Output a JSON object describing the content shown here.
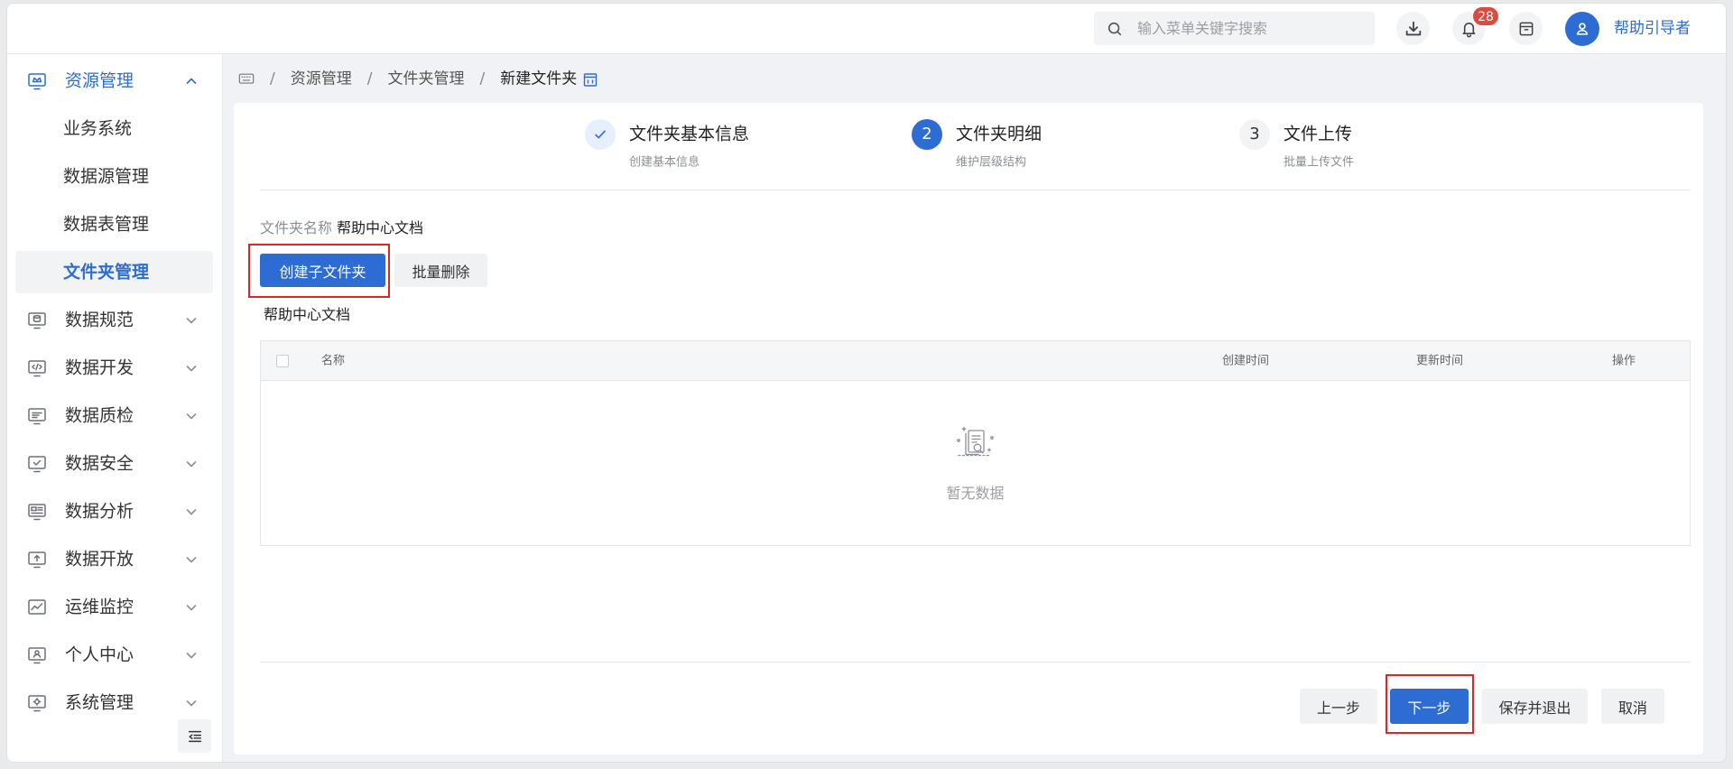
{
  "colors": {
    "primary": "#2d6cd3",
    "highlight": "#e02424",
    "badge": "#dc4a40"
  },
  "header": {
    "search_placeholder": "输入菜单关键字搜索",
    "search_icon": "search-icon",
    "notification_count": "28",
    "user_name": "帮助引导者",
    "icons": [
      "download-icon",
      "bell-icon",
      "archive-icon",
      "user-icon"
    ]
  },
  "sidebar": {
    "menu": [
      {
        "label": "资源管理",
        "icon": "resource-management-icon",
        "expanded": true,
        "children": [
          {
            "label": "业务系统"
          },
          {
            "label": "数据源管理"
          },
          {
            "label": "数据表管理"
          },
          {
            "label": "文件夹管理",
            "active": true
          }
        ]
      },
      {
        "label": "数据规范",
        "icon": "data-standard-icon"
      },
      {
        "label": "数据开发",
        "icon": "data-development-icon"
      },
      {
        "label": "数据质检",
        "icon": "data-quality-icon"
      },
      {
        "label": "数据安全",
        "icon": "data-security-icon"
      },
      {
        "label": "数据分析",
        "icon": "data-analysis-icon"
      },
      {
        "label": "数据开放",
        "icon": "data-open-icon"
      },
      {
        "label": "运维监控",
        "icon": "ops-monitor-icon"
      },
      {
        "label": "个人中心",
        "icon": "personal-center-icon"
      },
      {
        "label": "系统管理",
        "icon": "system-management-icon"
      }
    ],
    "collapse_icon": "collapse-sidebar-icon"
  },
  "breadcrumb": {
    "home_icon": "keyboard-icon",
    "items": [
      "资源管理",
      "文件夹管理",
      "新建文件夹"
    ],
    "trailing_icon": "page-tab-icon"
  },
  "steps": [
    {
      "icon": "check-icon",
      "title": "文件夹基本信息",
      "subtitle": "创建基本信息"
    },
    {
      "number": "2",
      "title": "文件夹明细",
      "subtitle": "维护层级结构",
      "current": true
    },
    {
      "number": "3",
      "title": "文件上传",
      "subtitle": "批量上传文件"
    }
  ],
  "folder": {
    "name_label": "文件夹名称",
    "name_value": "帮助中心文档"
  },
  "toolbar": {
    "create_subfolder": "创建子文件夹",
    "batch_delete": "批量删除"
  },
  "tree": {
    "root_label": "帮助中心文档"
  },
  "table": {
    "columns": [
      "名称",
      "创建时间",
      "更新时间",
      "操作"
    ],
    "rows": [],
    "empty_icon": "empty-data-icon",
    "empty_text": "暂无数据"
  },
  "footer": {
    "prev": "上一步",
    "next": "下一步",
    "save_exit": "保存并退出",
    "cancel": "取消"
  }
}
